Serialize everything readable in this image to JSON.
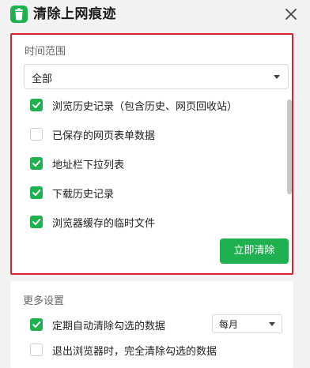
{
  "header": {
    "title": "清除上网痕迹",
    "app_icon": "trash-app-icon",
    "close_icon": "close-icon"
  },
  "time_range": {
    "label": "时间范围",
    "selected": "全部"
  },
  "items": [
    {
      "label": "浏览历史记录（包含历史、网页回收站）",
      "checked": true
    },
    {
      "label": "已保存的网页表单数据",
      "checked": false
    },
    {
      "label": "地址栏下拉列表",
      "checked": true
    },
    {
      "label": "下载历史记录",
      "checked": true
    },
    {
      "label": "浏览器缓存的临时文件",
      "checked": true
    }
  ],
  "clear_button": "立即清除",
  "more_settings": {
    "label": "更多设置",
    "auto_clear": {
      "label": "定期自动清除勾选的数据",
      "checked": true,
      "frequency": "每月"
    },
    "exit_clear": {
      "label": "退出浏览器时，完全清除勾选的数据",
      "checked": false
    }
  },
  "colors": {
    "accent": "#1fb050",
    "highlight_border": "#e0202a"
  }
}
